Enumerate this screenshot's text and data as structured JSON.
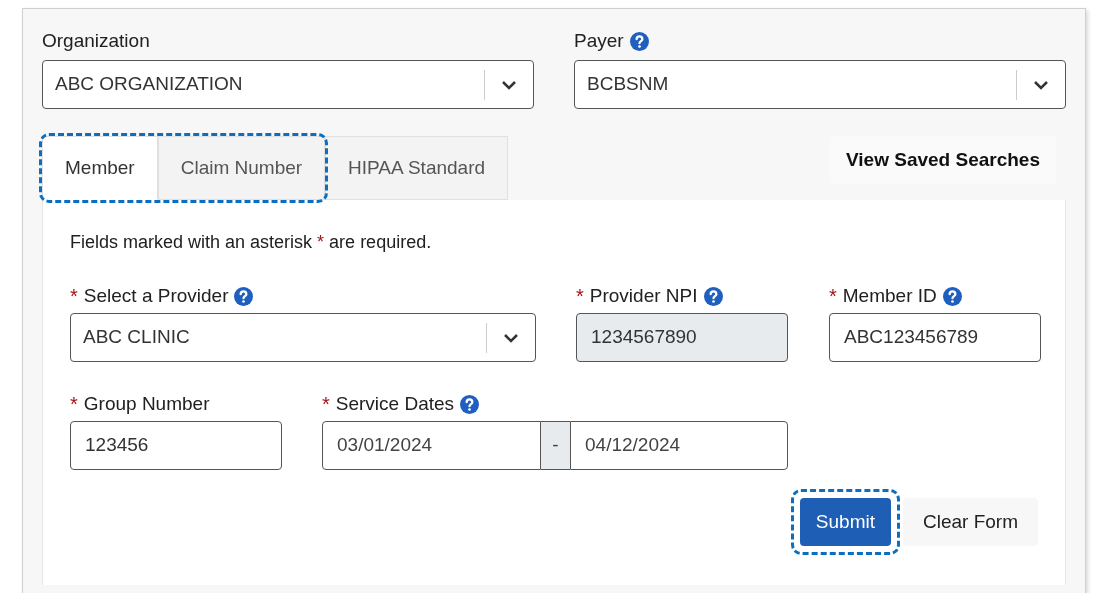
{
  "top_fields": [
    {
      "label": "Organization",
      "kind": "select",
      "value": "ABC ORGANIZATION"
    },
    {
      "label": "Payer",
      "help": true,
      "kind": "select",
      "value": "BCBSNM"
    }
  ],
  "tabs": [
    {
      "label": "Member",
      "selected": true,
      "highlighted": true
    },
    {
      "label": "Claim Number",
      "selected": false,
      "highlighted": true
    },
    {
      "label": "HIPAA Standard",
      "selected": false,
      "highlighted": false
    }
  ],
  "saved_searches_button": "View Saved Searches",
  "required_note": {
    "before": "Fields marked with an asterisk",
    "mark": "*",
    "after": "are required."
  },
  "rows": [
    [
      {
        "label": "Select a Provider",
        "required": true,
        "help": true,
        "kind": "select",
        "value": "ABC CLINIC"
      },
      {
        "label": "Provider NPI",
        "required": true,
        "help": true,
        "kind": "text",
        "value": "1234567890",
        "disabled": true
      },
      {
        "label": "Member ID",
        "required": true,
        "help": true,
        "kind": "text",
        "value": "ABC123456789",
        "disabled": false
      }
    ],
    [
      {
        "label": "Group Number",
        "required": true,
        "kind": "text",
        "value": "123456",
        "disabled": false
      },
      {
        "label": "Service Dates",
        "required": true,
        "help": true,
        "kind": "date_range",
        "from": "03/01/2024",
        "separator": "-",
        "to": "04/12/2024"
      }
    ]
  ],
  "buttons": [
    {
      "label": "Submit",
      "kind": "primary",
      "highlighted": true
    },
    {
      "label": "Clear Form",
      "kind": "secondary",
      "highlighted": false
    }
  ]
}
